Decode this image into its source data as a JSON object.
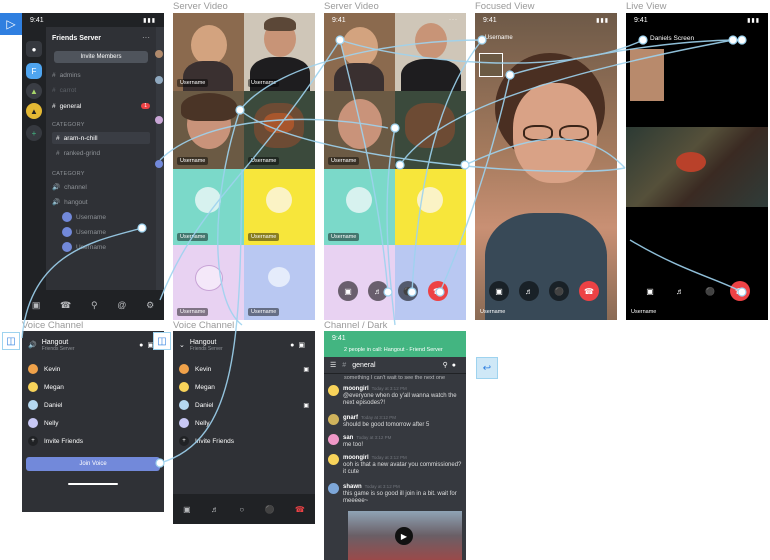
{
  "prototype_icon": "play-icon",
  "frame_labels": {
    "server_video_1": "Server Video",
    "server_video_2": "Server Video",
    "focused_view": "Focused View",
    "live_view": "Live View",
    "voice_channel_1": "Voice Channel",
    "voice_channel_2": "Voice Channel",
    "channel_dark": "Channel / Dark"
  },
  "status_time": "9:41",
  "server": {
    "name": "Friends Server",
    "menu": "···",
    "invite_button": "Invite Members",
    "channels": [
      {
        "name": "admins",
        "type": "text"
      },
      {
        "name": "carrot",
        "type": "text"
      },
      {
        "name": "general",
        "type": "text"
      }
    ],
    "unread": "1",
    "category_1": "CATEGORY",
    "cat1_channels": [
      "aram-n-chill",
      "ranked-grind"
    ],
    "category_2": "CATEGORY",
    "voice_channels": [
      "channel",
      "hangout"
    ],
    "voice_users": [
      "Username",
      "Username",
      "Username"
    ]
  },
  "video": {
    "tile_label": "Username",
    "focused_user": "Username",
    "live_user": "Daniels Screen"
  },
  "voice": {
    "channel": "Hangout",
    "server": "Friends Server",
    "members": [
      "Kevin",
      "Megan",
      "Daniel",
      "Nelly"
    ],
    "invite": "Invite Friends",
    "join": "Join Voice"
  },
  "chat": {
    "banner": "2 people in call: Hangout - Friend Server",
    "channel": "general",
    "top_text": "something I can't wait to see the next one",
    "messages": [
      {
        "user": "moongirl",
        "time": "Today at 3:12 PM",
        "text": "@everyone when do y'all wanna watch the next episodes?!",
        "color": "#f8d35a"
      },
      {
        "user": "gnarf",
        "time": "Today at 3:12 PM",
        "text": "should be good tomorrow after 5",
        "color": "#d0b35c"
      },
      {
        "user": "san",
        "time": "Today at 3:12 PM",
        "text": "me too!",
        "color": "#f098c8"
      },
      {
        "user": "moongirl",
        "time": "Today at 3:12 PM",
        "text": "ooh is that a new avatar you commissioned? it cute",
        "color": "#f8d35a"
      },
      {
        "user": "shawn",
        "time": "Today at 3:12 PM",
        "text": "this game is so good ill join in a bit. wait for meeeee~",
        "color": "#7da7d9"
      }
    ]
  },
  "colors": {
    "accent": "#7289da",
    "danger": "#ed4245",
    "online": "#43b581",
    "wire": "#9ed3ef"
  }
}
